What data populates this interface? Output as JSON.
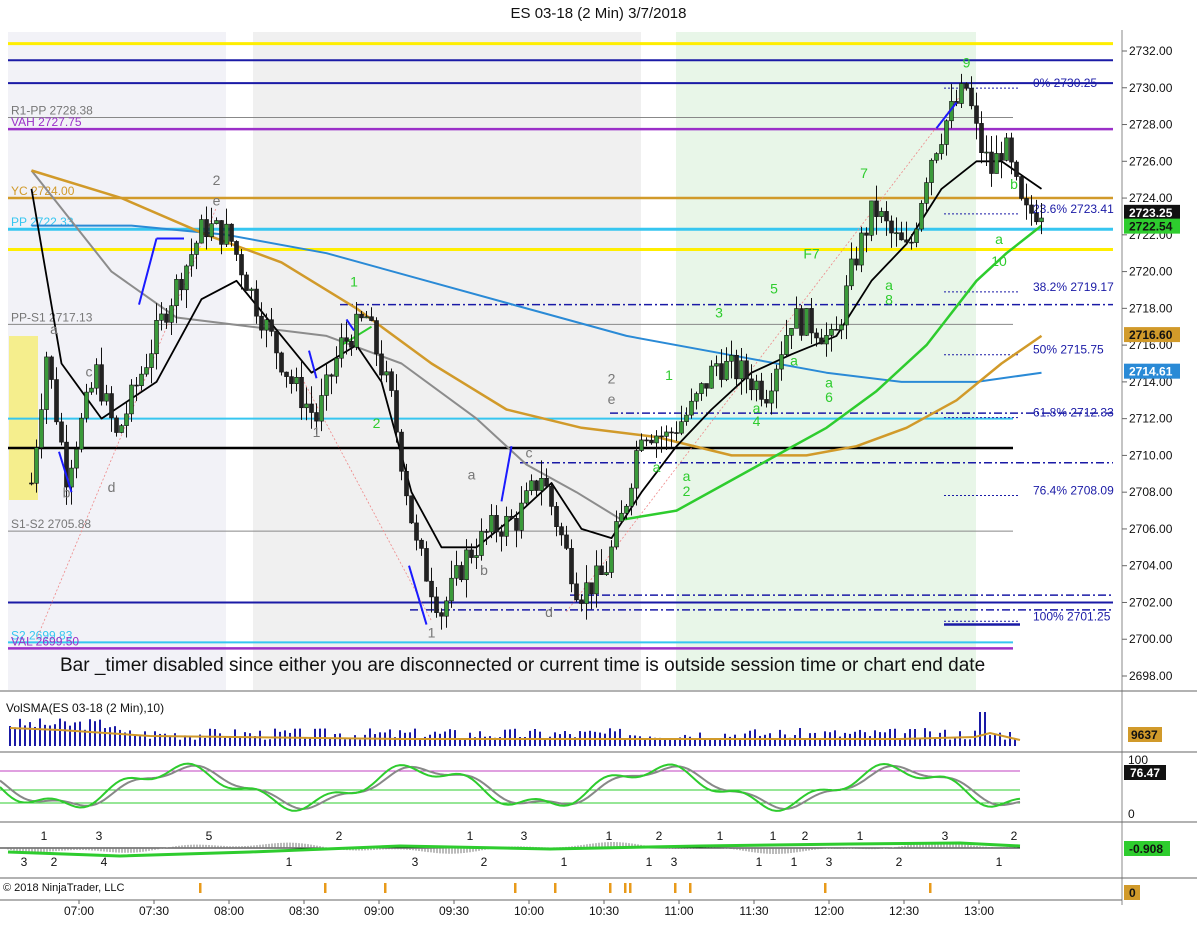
{
  "chart_title": "ES 03-18 (2 Min)  3/7/2018",
  "banner_text": "Bar _timer disabled since either you are disconnected or current time is outside session time or chart end date",
  "copyright": "© 2018 NinjaTrader, LLC",
  "colors": {
    "background": "#ffffff",
    "up_bar": "#3a9a3a",
    "down_bar": "#222222",
    "ema_fast": "#000000",
    "sma_gray": "#8c8c8c",
    "sma_gold": "#d19a2a",
    "sma_blue": "#2a8ad6",
    "sma_green": "#2ecc2e",
    "yellow": "#ffee00",
    "purple": "#9b30c8",
    "navy": "#1a1aa6",
    "cyan": "#36c6f0"
  },
  "chart_data": {
    "type": "candlestick",
    "x_tick_labels": [
      "07:00",
      "07:30",
      "08:00",
      "08:30",
      "09:00",
      "09:30",
      "10:00",
      "10:30",
      "11:00",
      "11:30",
      "12:00",
      "12:30",
      "13:00"
    ],
    "y_ticks": [
      "2732.00",
      "2730.00",
      "2728.00",
      "2726.00",
      "2724.00",
      "2722.00",
      "2720.00",
      "2718.00",
      "2716.00",
      "2714.00",
      "2712.00",
      "2710.00",
      "2708.00",
      "2706.00",
      "2704.00",
      "2702.00",
      "2700.00",
      "2698.00"
    ],
    "ylim": [
      2697,
      2733
    ],
    "price_path": [
      {
        "t": "06:41",
        "p": 2708.5
      },
      {
        "t": "06:47",
        "p": 2715.5
      },
      {
        "t": "06:55",
        "p": 2709.0
      },
      {
        "t": "07:07",
        "p": 2714.5
      },
      {
        "t": "07:15",
        "p": 2711.0
      },
      {
        "t": "07:35",
        "p": 2718.0
      },
      {
        "t": "07:50",
        "p": 2722.5
      },
      {
        "t": "08:00",
        "p": 2722.0
      },
      {
        "t": "08:10",
        "p": 2718.5
      },
      {
        "t": "08:25",
        "p": 2714.0
      },
      {
        "t": "08:35",
        "p": 2712.0
      },
      {
        "t": "08:45",
        "p": 2716.0
      },
      {
        "t": "08:55",
        "p": 2717.5
      },
      {
        "t": "09:05",
        "p": 2713.0
      },
      {
        "t": "09:15",
        "p": 2705.0
      },
      {
        "t": "09:25",
        "p": 2701.5
      },
      {
        "t": "09:35",
        "p": 2704.5
      },
      {
        "t": "09:45",
        "p": 2706.0
      },
      {
        "t": "09:55",
        "p": 2706.5
      },
      {
        "t": "10:05",
        "p": 2709.0
      },
      {
        "t": "10:12",
        "p": 2706.0
      },
      {
        "t": "10:20",
        "p": 2702.5
      },
      {
        "t": "10:30",
        "p": 2703.5
      },
      {
        "t": "10:38",
        "p": 2707.0
      },
      {
        "t": "10:45",
        "p": 2711.5
      },
      {
        "t": "10:55",
        "p": 2711.0
      },
      {
        "t": "11:05",
        "p": 2712.5
      },
      {
        "t": "11:15",
        "p": 2715.0
      },
      {
        "t": "11:25",
        "p": 2714.5
      },
      {
        "t": "11:35",
        "p": 2713.5
      },
      {
        "t": "11:45",
        "p": 2717.5
      },
      {
        "t": "11:55",
        "p": 2717.0
      },
      {
        "t": "12:02",
        "p": 2716.0
      },
      {
        "t": "12:10",
        "p": 2720.5
      },
      {
        "t": "12:18",
        "p": 2723.5
      },
      {
        "t": "12:25",
        "p": 2722.0
      },
      {
        "t": "12:32",
        "p": 2721.0
      },
      {
        "t": "12:40",
        "p": 2726.0
      },
      {
        "t": "12:48",
        "p": 2728.5
      },
      {
        "t": "12:55",
        "p": 2730.0
      },
      {
        "t": "13:00",
        "p": 2727.0
      },
      {
        "t": "13:05",
        "p": 2725.5
      },
      {
        "t": "13:10",
        "p": 2727.0
      },
      {
        "t": "13:18",
        "p": 2723.0
      },
      {
        "t": "13:25",
        "p": 2723.5
      }
    ],
    "ema_fast": [
      {
        "t": "06:41",
        "p": 2724.5
      },
      {
        "t": "06:53",
        "p": 2715.0
      },
      {
        "t": "07:09",
        "p": 2712.0
      },
      {
        "t": "07:31",
        "p": 2714.0
      },
      {
        "t": "07:49",
        "p": 2718.5
      },
      {
        "t": "08:03",
        "p": 2719.5
      },
      {
        "t": "08:21",
        "p": 2716.5
      },
      {
        "t": "08:33",
        "p": 2714.5
      },
      {
        "t": "08:51",
        "p": 2716.0
      },
      {
        "t": "09:01",
        "p": 2714.0
      },
      {
        "t": "09:13",
        "p": 2708.0
      },
      {
        "t": "09:25",
        "p": 2705.0
      },
      {
        "t": "09:39",
        "p": 2705.0
      },
      {
        "t": "09:57",
        "p": 2707.0
      },
      {
        "t": "10:09",
        "p": 2708.5
      },
      {
        "t": "10:21",
        "p": 2706.0
      },
      {
        "t": "10:33",
        "p": 2705.5
      },
      {
        "t": "10:45",
        "p": 2708.0
      },
      {
        "t": "10:59",
        "p": 2710.5
      },
      {
        "t": "11:13",
        "p": 2712.5
      },
      {
        "t": "11:29",
        "p": 2714.5
      },
      {
        "t": "11:45",
        "p": 2715.5
      },
      {
        "t": "12:03",
        "p": 2716.5
      },
      {
        "t": "12:17",
        "p": 2719.5
      },
      {
        "t": "12:31",
        "p": 2721.5
      },
      {
        "t": "12:45",
        "p": 2724.5
      },
      {
        "t": "12:59",
        "p": 2726.0
      },
      {
        "t": "13:09",
        "p": 2726.0
      },
      {
        "t": "13:25",
        "p": 2724.5
      }
    ],
    "sma_gray": [
      {
        "t": "06:41",
        "p": 2725.5
      },
      {
        "t": "07:13",
        "p": 2720.0
      },
      {
        "t": "07:39",
        "p": 2717.5
      },
      {
        "t": "08:09",
        "p": 2717.0
      },
      {
        "t": "08:39",
        "p": 2716.5
      },
      {
        "t": "09:09",
        "p": 2715.0
      },
      {
        "t": "09:39",
        "p": 2712.0
      },
      {
        "t": "09:59",
        "p": 2709.5
      },
      {
        "t": "10:19",
        "p": 2708.0
      },
      {
        "t": "10:37",
        "p": 2706.5
      }
    ],
    "sma_gold": [
      {
        "t": "06:41",
        "p": 2725.5
      },
      {
        "t": "07:17",
        "p": 2724.0
      },
      {
        "t": "07:51",
        "p": 2722.0
      },
      {
        "t": "08:21",
        "p": 2720.5
      },
      {
        "t": "08:51",
        "p": 2718.0
      },
      {
        "t": "09:21",
        "p": 2715.0
      },
      {
        "t": "09:51",
        "p": 2712.5
      },
      {
        "t": "10:21",
        "p": 2711.5
      },
      {
        "t": "10:51",
        "p": 2711.0
      },
      {
        "t": "11:21",
        "p": 2710.0
      },
      {
        "t": "11:51",
        "p": 2710.0
      },
      {
        "t": "12:11",
        "p": 2710.5
      },
      {
        "t": "12:31",
        "p": 2711.5
      },
      {
        "t": "12:51",
        "p": 2713.0
      },
      {
        "t": "13:09",
        "p": 2715.0
      },
      {
        "t": "13:25",
        "p": 2716.5
      }
    ],
    "sma_blue": [
      {
        "t": "06:41",
        "p": 2722.5
      },
      {
        "t": "07:21",
        "p": 2722.5
      },
      {
        "t": "07:59",
        "p": 2722.0
      },
      {
        "t": "08:39",
        "p": 2721.0
      },
      {
        "t": "09:19",
        "p": 2719.5
      },
      {
        "t": "09:59",
        "p": 2718.0
      },
      {
        "t": "10:39",
        "p": 2716.5
      },
      {
        "t": "11:19",
        "p": 2715.5
      },
      {
        "t": "11:59",
        "p": 2714.5
      },
      {
        "t": "12:29",
        "p": 2714.0
      },
      {
        "t": "12:59",
        "p": 2714.0
      },
      {
        "t": "13:25",
        "p": 2714.5
      }
    ],
    "sma_green": [
      {
        "t": "08:45",
        "p": 2716.0
      },
      {
        "t": "08:57",
        "p": 2717.0
      },
      {
        "t": "10:37",
        "p": 2706.5
      },
      {
        "t": "10:59",
        "p": 2707.0
      },
      {
        "t": "11:19",
        "p": 2708.5
      },
      {
        "t": "11:39",
        "p": 2710.0
      },
      {
        "t": "11:59",
        "p": 2711.5
      },
      {
        "t": "12:19",
        "p": 2713.5
      },
      {
        "t": "12:39",
        "p": 2716.0
      },
      {
        "t": "12:59",
        "p": 2719.5
      },
      {
        "t": "13:11",
        "p": 2721.0
      },
      {
        "t": "13:25",
        "p": 2722.5
      }
    ],
    "levels": [
      {
        "label": "R1-PP 2728.38",
        "price": 2728.38,
        "color": "#777777"
      },
      {
        "label": "VAH 2727.75",
        "price": 2727.75,
        "color": "#9b30c8"
      },
      {
        "label": "YC 2724.00",
        "price": 2724.0,
        "color": "#d19a2a"
      },
      {
        "label": "PP 2722.33",
        "price": 2722.33,
        "color": "#36c6f0"
      },
      {
        "label": "PP-S1 2717.13",
        "price": 2717.13,
        "color": "#777777"
      },
      {
        "label": "S1-S2 2705.88",
        "price": 2705.88,
        "color": "#777777"
      },
      {
        "label": "S2 2699.83",
        "price": 2699.83,
        "color": "#36c6f0"
      },
      {
        "label": "VAL 2699.50",
        "price": 2699.5,
        "color": "#9b30c8"
      }
    ],
    "fib_levels": [
      {
        "label": "0%  2730.25",
        "price": 2730.25
      },
      {
        "label": "23.6%  2723.41",
        "price": 2723.41
      },
      {
        "label": "38.2%  2719.17",
        "price": 2719.17
      },
      {
        "label": "50%  2715.75",
        "price": 2715.75
      },
      {
        "label": "61.8%  2712.33",
        "price": 2712.33
      },
      {
        "label": "76.4%  2708.09",
        "price": 2708.09
      },
      {
        "label": "100%  2701.25",
        "price": 2701.25
      }
    ],
    "price_badges": [
      {
        "text": "2723.25",
        "price": 2723.25,
        "bg": "#111111",
        "fg": "#ffffff"
      },
      {
        "text": "2722.54",
        "price": 2722.5,
        "bg": "#2ecc2e",
        "fg": "#111111"
      },
      {
        "text": "2716.60",
        "price": 2716.6,
        "bg": "#d19a2a",
        "fg": "#111111"
      },
      {
        "text": "2714.61",
        "price": 2714.61,
        "bg": "#2a8ad6",
        "fg": "#ffffff"
      }
    ],
    "swing_labels": [
      {
        "text": "a",
        "t": "06:50",
        "p": 2716.6,
        "color": "#777777"
      },
      {
        "text": "b",
        "t": "06:55",
        "p": 2707.7,
        "color": "#777777"
      },
      {
        "text": "c",
        "t": "07:04",
        "p": 2714.3,
        "color": "#777777"
      },
      {
        "text": "d",
        "t": "07:13",
        "p": 2708.0,
        "color": "#777777"
      },
      {
        "text": "2",
        "t": "07:55",
        "p": 2724.7,
        "color": "#777777"
      },
      {
        "text": "e",
        "t": "07:55",
        "p": 2723.6,
        "color": "#777777"
      },
      {
        "text": "1",
        "t": "08:35",
        "p": 2711.0,
        "color": "#777777"
      },
      {
        "text": "1",
        "t": "08:50",
        "p": 2719.2,
        "color": "#2ecc2e"
      },
      {
        "text": "2",
        "t": "08:59",
        "p": 2711.5,
        "color": "#2ecc2e"
      },
      {
        "text": "1",
        "t": "09:21",
        "p": 2700.1,
        "color": "#777777"
      },
      {
        "text": "a",
        "t": "09:37",
        "p": 2708.7,
        "color": "#777777"
      },
      {
        "text": "b",
        "t": "09:42",
        "p": 2703.5,
        "color": "#777777"
      },
      {
        "text": "c",
        "t": "10:00",
        "p": 2709.9,
        "color": "#777777"
      },
      {
        "text": "d",
        "t": "10:08",
        "p": 2701.2,
        "color": "#777777"
      },
      {
        "text": "2",
        "t": "10:33",
        "p": 2713.9,
        "color": "#777777"
      },
      {
        "text": "e",
        "t": "10:33",
        "p": 2712.8,
        "color": "#777777"
      },
      {
        "text": "a",
        "t": "10:51",
        "p": 2709.1,
        "color": "#2ecc2e"
      },
      {
        "text": "1",
        "t": "10:56",
        "p": 2714.1,
        "color": "#2ecc2e"
      },
      {
        "text": "a",
        "t": "11:03",
        "p": 2708.6,
        "color": "#2ecc2e"
      },
      {
        "text": "2",
        "t": "11:03",
        "p": 2707.8,
        "color": "#2ecc2e"
      },
      {
        "text": "3",
        "t": "11:16",
        "p": 2717.5,
        "color": "#2ecc2e"
      },
      {
        "text": "a",
        "t": "11:31",
        "p": 2712.3,
        "color": "#2ecc2e"
      },
      {
        "text": "4",
        "t": "11:31",
        "p": 2711.6,
        "color": "#2ecc2e"
      },
      {
        "text": "5",
        "t": "11:38",
        "p": 2718.8,
        "color": "#2ecc2e"
      },
      {
        "text": "a",
        "t": "11:46",
        "p": 2714.9,
        "color": "#2ecc2e"
      },
      {
        "text": "F7",
        "t": "11:53",
        "p": 2720.7,
        "color": "#2ecc2e"
      },
      {
        "text": "a",
        "t": "12:00",
        "p": 2713.7,
        "color": "#2ecc2e"
      },
      {
        "text": "6",
        "t": "12:00",
        "p": 2712.9,
        "color": "#2ecc2e"
      },
      {
        "text": "7",
        "t": "12:14",
        "p": 2725.1,
        "color": "#2ecc2e"
      },
      {
        "text": "a",
        "t": "12:24",
        "p": 2719.0,
        "color": "#2ecc2e"
      },
      {
        "text": "8",
        "t": "12:24",
        "p": 2718.2,
        "color": "#2ecc2e"
      },
      {
        "text": "9",
        "t": "12:55",
        "p": 2731.1,
        "color": "#2ecc2e"
      },
      {
        "text": "b",
        "t": "13:14",
        "p": 2724.5,
        "color": "#2ecc2e"
      },
      {
        "text": "a",
        "t": "13:08",
        "p": 2721.5,
        "color": "#2ecc2e"
      },
      {
        "text": "10",
        "t": "13:08",
        "p": 2720.3,
        "color": "#2ecc2e"
      }
    ]
  },
  "volume_panel": {
    "title": "VolSMA(ES 03-18 (2 Min),10)",
    "value_badge": "9637",
    "y_tick": ""
  },
  "stoch_panel": {
    "ticks": [
      "100",
      "0"
    ],
    "value_badge": "76.47"
  },
  "osc_panel": {
    "value_badge": "-0.908",
    "upper_labels": [
      "1",
      "3",
      "5",
      "2",
      "1",
      "3",
      "1",
      "2",
      "1",
      "1",
      "2",
      "1",
      "3",
      "2"
    ],
    "lower_labels": [
      "3",
      "2",
      "4",
      "1",
      "3",
      "2",
      "1",
      "1",
      "3",
      "1",
      "1",
      "3",
      "2",
      "1"
    ]
  },
  "alert_panel": {
    "value_badge": "0"
  }
}
